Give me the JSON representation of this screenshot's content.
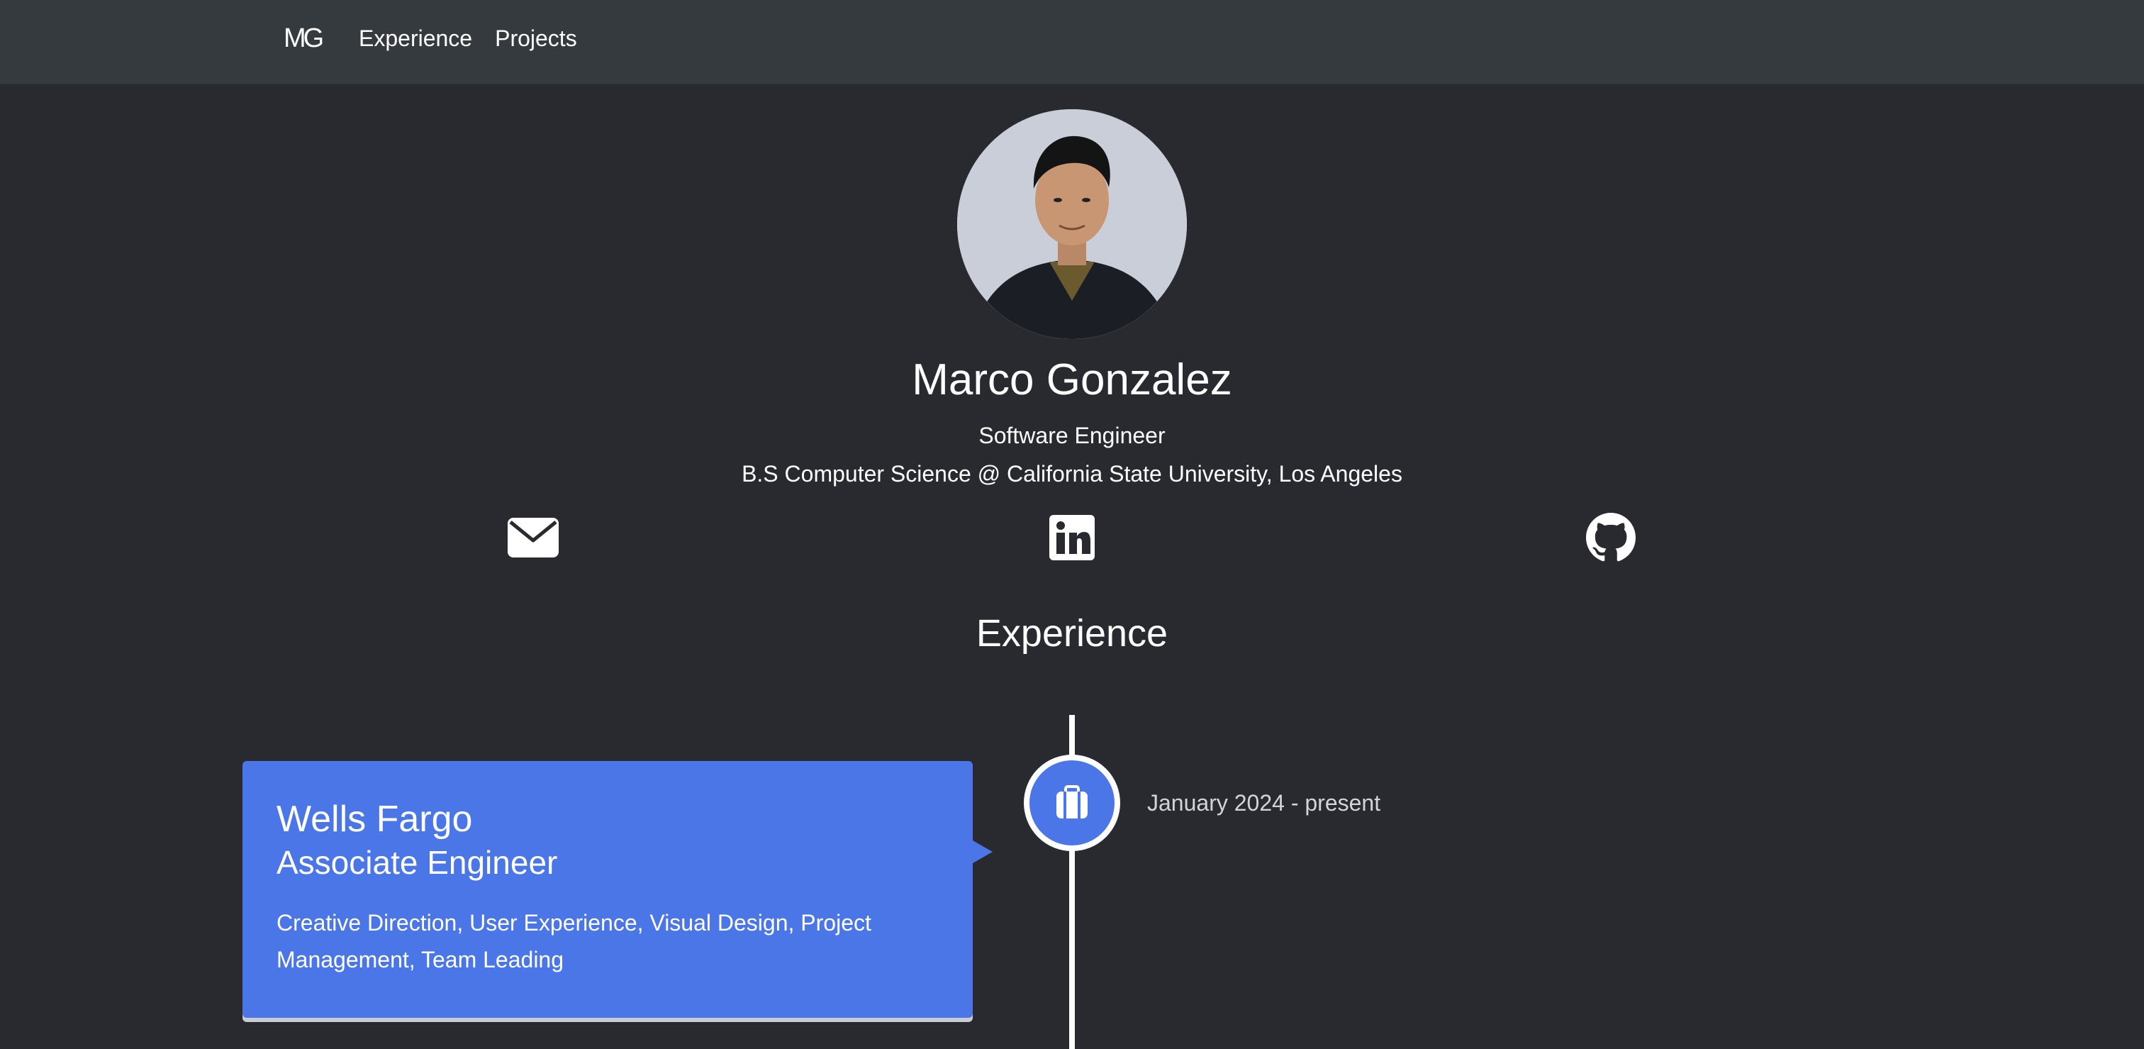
{
  "nav": {
    "brand": "MG",
    "links": [
      {
        "label": "Experience"
      },
      {
        "label": "Projects"
      }
    ]
  },
  "profile": {
    "name": "Marco Gonzalez",
    "role": "Software Engineer",
    "education": "B.S Computer Science @ California State University, Los Angeles"
  },
  "social": [
    {
      "icon": "email-icon"
    },
    {
      "icon": "linkedin-icon"
    },
    {
      "icon": "github-icon"
    }
  ],
  "experience": {
    "title": "Experience",
    "items": [
      {
        "company": "Wells Fargo",
        "title": "Associate Engineer",
        "description": "Creative Direction, User Experience, Visual Design, Project Management, Team Leading",
        "date": "January 2024 - present",
        "icon": "briefcase-icon"
      }
    ]
  },
  "colors": {
    "background": "#282a30",
    "navbar": "#353a3e",
    "accent": "#4a76e8",
    "text": "#ffffff",
    "muted": "#d2d4d8"
  }
}
